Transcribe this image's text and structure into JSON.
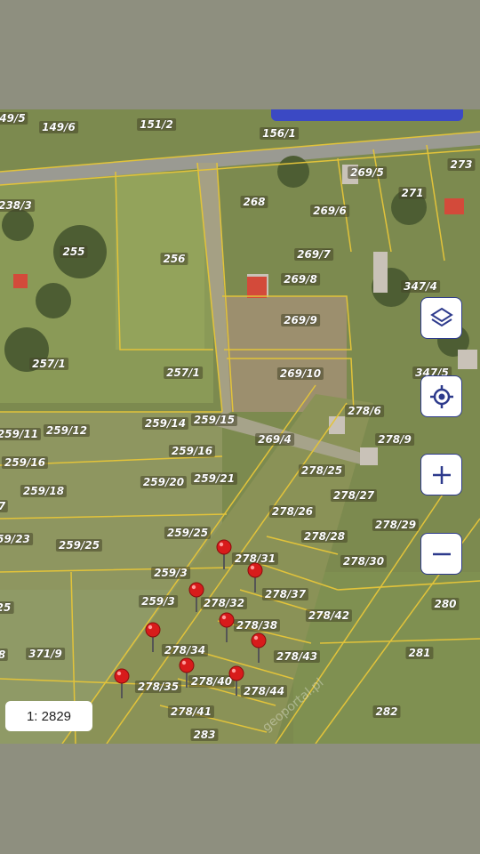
{
  "map": {
    "scale_label": "1: 2829",
    "controls": [
      {
        "name": "layers-button",
        "icon": "layers-icon"
      },
      {
        "name": "locate-button",
        "icon": "crosshair-icon"
      },
      {
        "name": "zoom-in-button",
        "icon": "plus-icon"
      },
      {
        "name": "zoom-out-button",
        "icon": "minus-icon"
      }
    ],
    "parcels": [
      "49/5",
      "149/6",
      "151/2",
      "156/1",
      "269/5",
      "273",
      "238/3",
      "268",
      "269/6",
      "271",
      "255",
      "256",
      "269/7",
      "269/8",
      "347/4",
      "269/9",
      "257/1",
      "257/1",
      "269/10",
      "347/5",
      "278/6",
      "259/11",
      "259/12",
      "259/14",
      "259/15",
      "269/4",
      "278/9",
      "259/16",
      "259/16",
      "278/25",
      "7",
      "259/18",
      "259/20",
      "259/21",
      "278/27",
      "278/29",
      "278/26",
      "59/23",
      "259/25",
      "259/25",
      "278/28",
      "278/31",
      "278/30",
      "259/3",
      "25",
      "259/3",
      "278/32",
      "278/37",
      "280",
      "278/42",
      "8",
      "371/9",
      "278/34",
      "278/38",
      "278/43",
      "281",
      "278/35",
      "278/40",
      "278/44",
      "278/41",
      "282",
      "283"
    ],
    "pins_count": 9,
    "colors": {
      "pin": "#d81b1b",
      "parcel_line": "#e2c33a",
      "control_border": "#2d3a8c",
      "accent": "#3b49c4"
    }
  }
}
